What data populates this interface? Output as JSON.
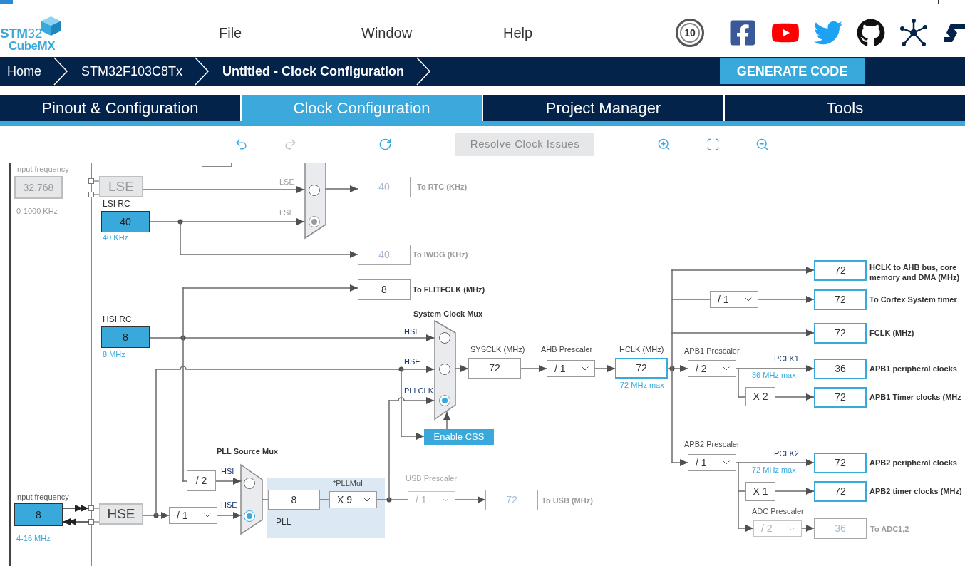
{
  "header": {
    "logo": {
      "line_1": "**STM**32",
      "line_2": "CubeMX"
    },
    "menu": [
      "File",
      "Window",
      "Help"
    ],
    "badge": "10"
  },
  "breadcrumb": [
    {
      "label": "Home",
      "current": false
    },
    {
      "label": "STM32F103C8Tx",
      "current": false
    },
    {
      "label": "Untitled - Clock Configuration",
      "current": true
    }
  ],
  "generate_button": "GENERATE CODE",
  "tabs": [
    {
      "label": "Pinout & Configuration",
      "selected": false
    },
    {
      "label": "Clock Configuration",
      "selected": true
    },
    {
      "label": "Project Manager",
      "selected": false
    },
    {
      "label": "Tools",
      "selected": false
    }
  ],
  "toolbar": {
    "tools": [
      {
        "kind": "undo",
        "disabled": false
      },
      {
        "kind": "redo",
        "disabled": true
      },
      {
        "kind": "reset",
        "disabled": false
      },
      {
        "kind": "resolve",
        "label": "Resolve Clock Issues",
        "disabled": true
      },
      {
        "kind": "zoom_in",
        "disabled": false
      },
      {
        "kind": "fit",
        "disabled": false
      },
      {
        "kind": "zoom_out",
        "disabled": false
      }
    ]
  },
  "clock_tree": {
    "lse_input": {
      "caption": "Input frequency",
      "value": "32.768",
      "range": "0-1000 KHz",
      "enabled": false
    },
    "lse": {
      "label": "LSE",
      "enabled": false
    },
    "lsi_rc": {
      "label": "LSI RC",
      "value": "40",
      "frequency": "40 KHz"
    },
    "rtc_mux": {
      "enabled": false,
      "inputs": [
        {
          "label": "LSE",
          "selected": false
        },
        {
          "label": "LSI",
          "selected": true
        }
      ]
    },
    "rtc_output": {
      "value": "40",
      "label": "To RTC (KHz)",
      "enabled": false
    },
    "iwdg_output": {
      "value": "40",
      "label": "To IWDG (KHz)",
      "enabled": false
    },
    "flitf_output": {
      "value": "8",
      "label": "To FLITFCLK (MHz)",
      "enabled": true
    },
    "hsi_rc": {
      "label": "HSI RC",
      "value": "8",
      "frequency": "8 MHz"
    },
    "system_mux": {
      "title": "System Clock Mux",
      "inputs": [
        {
          "label": "HSI",
          "selected": false
        },
        {
          "label": "HSE",
          "selected": false
        },
        {
          "label": "PLLCLK",
          "selected": true
        }
      ]
    },
    "sysclk": {
      "label": "SYSCLK (MHz)",
      "value": "72"
    },
    "ahb_prescaler": {
      "label": "AHB Prescaler",
      "value": "/ 1"
    },
    "hclk": {
      "label": "HCLK (MHz)",
      "value": "72",
      "max": "72 MHz max"
    },
    "enable_css": {
      "label": "Enable CSS"
    },
    "pll_source_mux": {
      "title": "PLL Source Mux",
      "hsi_divider": "/ 2",
      "hse_divider": "/ 1",
      "inputs": [
        {
          "label": "HSI",
          "selected": false
        },
        {
          "label": "HSE",
          "selected": true
        }
      ]
    },
    "hse_input": {
      "caption": "Input frequency",
      "value": "8",
      "range": "4-16 MHz",
      "enabled": true
    },
    "hse": {
      "label": "HSE",
      "enabled": true
    },
    "pll": {
      "label": "PLL",
      "value": "8",
      "multiplier_label": "*PLLMul",
      "multiplier": "X 9"
    },
    "usb": {
      "label": "USB Prescaler",
      "prescaler": "/ 1",
      "value": "72",
      "output": "To USB (MHz)",
      "enabled": false
    },
    "cortex_prescaler": {
      "value": "/ 1"
    },
    "apb1": {
      "label": "APB1 Prescaler",
      "prescaler": "/ 2",
      "clock": "PCLK1",
      "max": "36 MHz max",
      "timer_multiplier": "X 2"
    },
    "apb2": {
      "label": "APB2 Prescaler",
      "prescaler": "/ 1",
      "clock": "PCLK2",
      "max": "72 MHz max",
      "timer_multiplier": "X 1"
    },
    "adc": {
      "label": "ADC Prescaler",
      "prescaler": "/ 2",
      "value": "36",
      "output": "To ADC1,2",
      "enabled": false
    },
    "bus_outputs": [
      {
        "value": "72",
        "label": "HCLK to AHB bus, core",
        "label_2": "memory and DMA (MHz)"
      },
      {
        "value": "72",
        "label": "To Cortex System timer"
      },
      {
        "value": "72",
        "label": "FCLK (MHz)"
      },
      {
        "value": "36",
        "label": "APB1 peripheral clocks"
      },
      {
        "value": "72",
        "label": "APB1 Timer clocks (MHz"
      },
      {
        "value": "72",
        "label": "APB2 peripheral clocks"
      },
      {
        "value": "72",
        "label": "APB2 timer clocks (MHz)"
      }
    ]
  }
}
